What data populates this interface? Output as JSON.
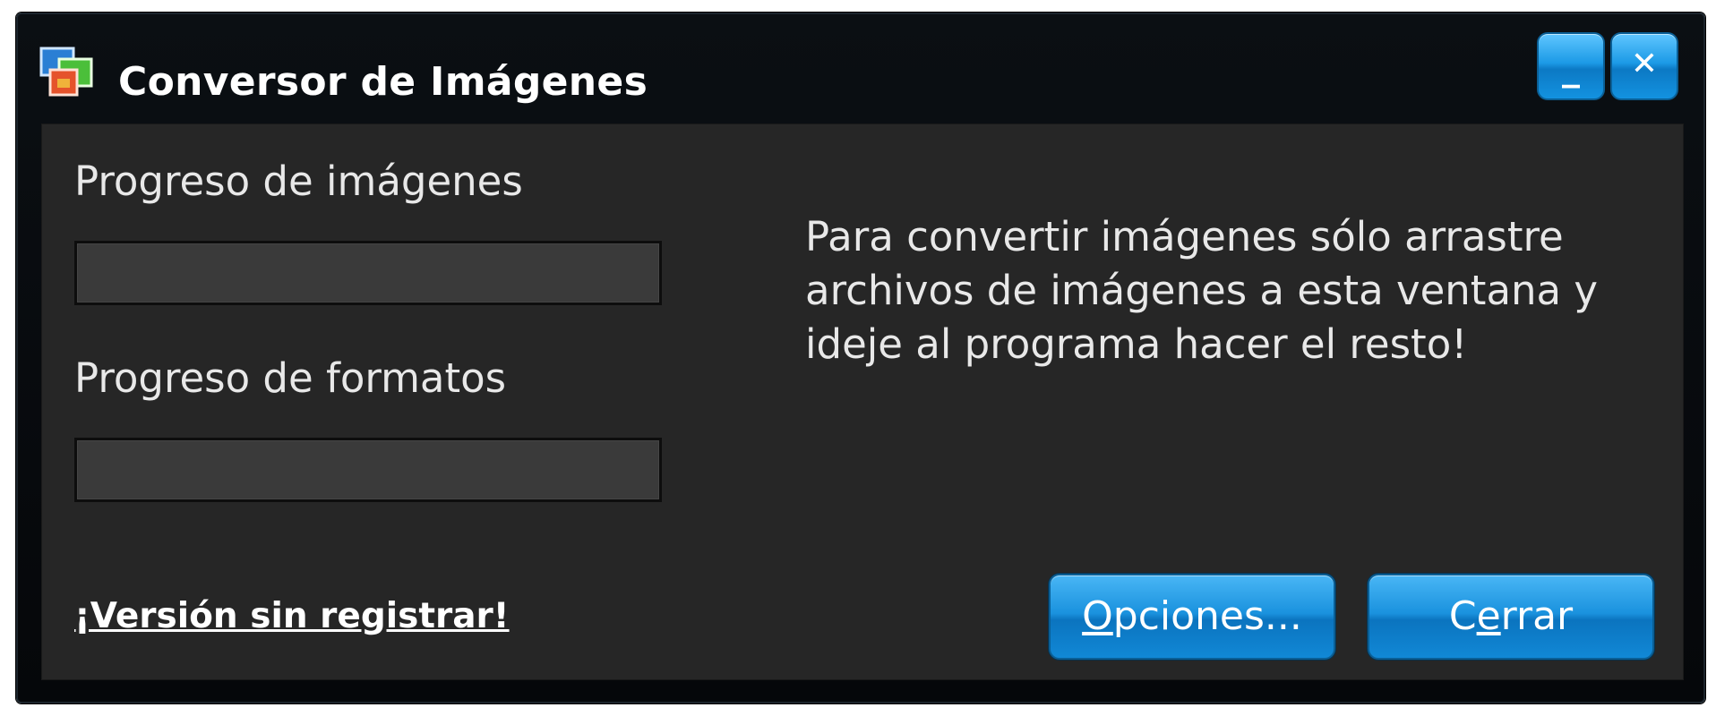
{
  "window": {
    "title": "Conversor de Imágenes",
    "minimize_glyph": "_",
    "close_glyph": "✕"
  },
  "progress": {
    "images_label": "Progreso de imágenes",
    "images_value": 0,
    "formats_label": "Progreso de formatos",
    "formats_value": 0
  },
  "instructions": "Para convertir imágenes sólo arrastre\narchivos de imágenes a esta ventana y\nideje al programa hacer el resto!",
  "unregistered_link": "¡Versión sin registrar!",
  "buttons": {
    "options": {
      "access_key": "O",
      "rest": "pciones..."
    },
    "close": {
      "before": "C",
      "access_key": "e",
      "after": "rrar"
    }
  },
  "colors": {
    "accent_blue": "#1a92de",
    "panel_bg": "#262626",
    "frame_bg": "#05070a"
  },
  "icons": [
    "app-windows-icon",
    "minimize-icon",
    "close-icon"
  ]
}
